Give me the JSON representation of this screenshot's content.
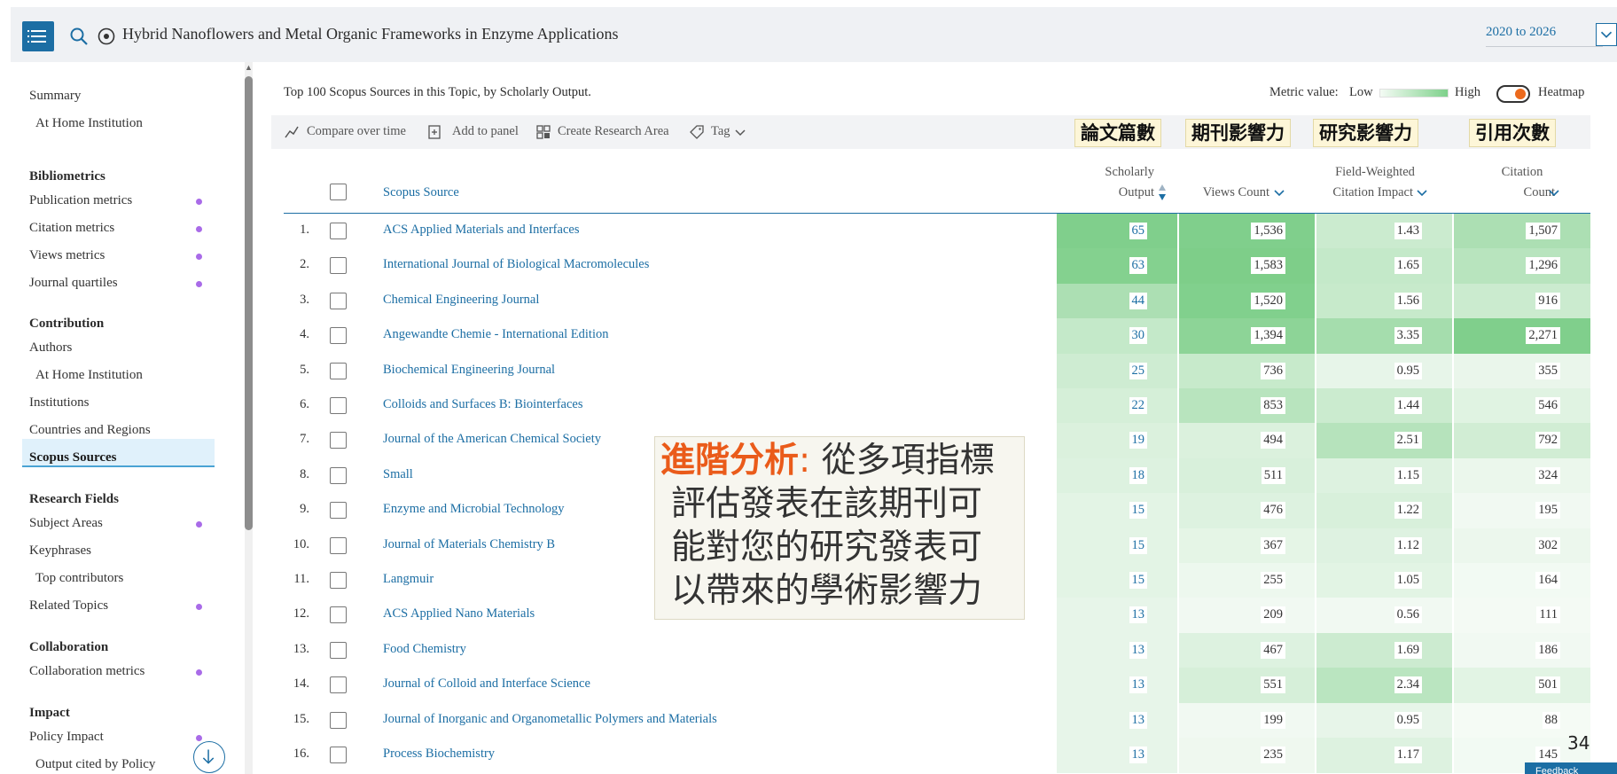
{
  "topbar": {
    "title": "Hybrid Nanoflowers and Metal Organic Frameworks in Enzyme Applications",
    "year_range": "2020 to 2026",
    "icons": [
      "menu-icon",
      "search-icon",
      "topic-icon",
      "chevron-down-icon"
    ]
  },
  "sidebar": {
    "items": [
      {
        "label": "Summary",
        "type": "item"
      },
      {
        "label": "At Home Institution",
        "type": "subitem"
      },
      {
        "label": "Bibliometrics",
        "type": "heading"
      },
      {
        "label": "Publication metrics",
        "type": "item",
        "dot": true
      },
      {
        "label": "Citation metrics",
        "type": "item",
        "dot": true
      },
      {
        "label": "Views metrics",
        "type": "item",
        "dot": true
      },
      {
        "label": "Journal quartiles",
        "type": "item",
        "dot": true
      },
      {
        "label": "Contribution",
        "type": "heading"
      },
      {
        "label": "Authors",
        "type": "item"
      },
      {
        "label": "At Home Institution",
        "type": "subitem"
      },
      {
        "label": "Institutions",
        "type": "item"
      },
      {
        "label": "Countries and Regions",
        "type": "item"
      },
      {
        "label": "Scopus Sources",
        "type": "item",
        "active": true
      },
      {
        "label": "Research Fields",
        "type": "heading"
      },
      {
        "label": "Subject Areas",
        "type": "item",
        "dot": true
      },
      {
        "label": "Keyphrases",
        "type": "item"
      },
      {
        "label": "Top contributors",
        "type": "subitem"
      },
      {
        "label": "Related Topics",
        "type": "item",
        "dot": true
      },
      {
        "label": "Collaboration",
        "type": "heading"
      },
      {
        "label": "Collaboration metrics",
        "type": "item",
        "dot": true
      },
      {
        "label": "Impact",
        "type": "heading"
      },
      {
        "label": "Policy Impact",
        "type": "item",
        "dot": true
      },
      {
        "label": "Output cited by Policy",
        "type": "subitem"
      }
    ],
    "dot_color": "#a96be8"
  },
  "main": {
    "title": "Top 100 Scopus Sources in this Topic, by Scholarly Output.",
    "metric_value_label": "Metric value:",
    "metric_low": "Low",
    "metric_high": "High",
    "heatmap_label": "Heatmap",
    "heatmap_on": true
  },
  "toolbar": {
    "compare_label": "Compare over time",
    "add_panel_label": "Add to panel",
    "create_area_label": "Create Research Area",
    "tag_label": "Tag"
  },
  "zh_labels": {
    "output": "論文篇數",
    "journal_impact": "期刊影響力",
    "research_impact": "研究影響力",
    "citations": "引用次數"
  },
  "table": {
    "headers": {
      "source": "Scopus Source",
      "scholarly_output_line1": "Scholarly",
      "scholarly_output_line2": "Output",
      "views": "Views Count",
      "fwci_line1": "Field-Weighted",
      "fwci_line2": "Citation Impact",
      "citation_line1": "Citation",
      "citation_line2": "Count"
    },
    "rows": [
      {
        "num": "1.",
        "source": "ACS Applied Materials and Interfaces",
        "output": "65",
        "views": "1,536",
        "fwci": "1.43",
        "citations": "1,507",
        "h": [
          0.95,
          0.95,
          0.35,
          0.6
        ]
      },
      {
        "num": "2.",
        "source": "International Journal of Biological Macromolecules",
        "output": "63",
        "views": "1,583",
        "fwci": "1.65",
        "citations": "1,296",
        "h": [
          0.92,
          0.97,
          0.4,
          0.5
        ]
      },
      {
        "num": "3.",
        "source": "Chemical Engineering Journal",
        "output": "44",
        "views": "1,520",
        "fwci": "1.56",
        "citations": "916",
        "h": [
          0.6,
          0.94,
          0.38,
          0.35
        ]
      },
      {
        "num": "4.",
        "source": "Angewandte Chemie - International Edition",
        "output": "30",
        "views": "1,394",
        "fwci": "3.35",
        "citations": "2,271",
        "h": [
          0.4,
          0.85,
          0.65,
          0.95
        ]
      },
      {
        "num": "5.",
        "source": "Biochemical Engineering Journal",
        "output": "25",
        "views": "736",
        "fwci": "0.95",
        "citations": "355",
        "h": [
          0.32,
          0.38,
          0.12,
          0.1
        ]
      },
      {
        "num": "6.",
        "source": "Colloids and Surfaces B: Biointerfaces",
        "output": "22",
        "views": "853",
        "fwci": "1.44",
        "citations": "546",
        "h": [
          0.27,
          0.5,
          0.35,
          0.18
        ]
      },
      {
        "num": "7.",
        "source": "Journal of the American Chemical Society",
        "output": "19",
        "views": "494",
        "fwci": "2.51",
        "citations": "792",
        "h": [
          0.22,
          0.22,
          0.52,
          0.3
        ]
      },
      {
        "num": "8.",
        "source": "Small",
        "output": "18",
        "views": "511",
        "fwci": "1.15",
        "citations": "324",
        "h": [
          0.2,
          0.24,
          0.2,
          0.09
        ]
      },
      {
        "num": "9.",
        "source": "Enzyme and Microbial Technology",
        "output": "15",
        "views": "476",
        "fwci": "1.22",
        "citations": "195",
        "h": [
          0.15,
          0.2,
          0.24,
          0.04
        ]
      },
      {
        "num": "10.",
        "source": "Journal of Materials Chemistry B",
        "output": "15",
        "views": "367",
        "fwci": "1.12",
        "citations": "302",
        "h": [
          0.15,
          0.14,
          0.19,
          0.08
        ]
      },
      {
        "num": "11.",
        "source": "Langmuir",
        "output": "15",
        "views": "255",
        "fwci": "1.05",
        "citations": "164",
        "h": [
          0.15,
          0.07,
          0.16,
          0.03
        ]
      },
      {
        "num": "12.",
        "source": "ACS Applied Nano Materials",
        "output": "13",
        "views": "209",
        "fwci": "0.56",
        "citations": "111",
        "h": [
          0.12,
          0.04,
          0.04,
          0.02
        ]
      },
      {
        "num": "13.",
        "source": "Food Chemistry",
        "output": "13",
        "views": "467",
        "fwci": "1.69",
        "citations": "186",
        "h": [
          0.12,
          0.2,
          0.34,
          0.04
        ]
      },
      {
        "num": "14.",
        "source": "Journal of Colloid and Interface Science",
        "output": "13",
        "views": "551",
        "fwci": "2.34",
        "citations": "501",
        "h": [
          0.12,
          0.26,
          0.48,
          0.16
        ]
      },
      {
        "num": "15.",
        "source": "Journal of Inorganic and Organometallic Polymers and Materials",
        "output": "13",
        "views": "199",
        "fwci": "0.95",
        "citations": "88",
        "h": [
          0.12,
          0.04,
          0.12,
          0.01
        ]
      },
      {
        "num": "16.",
        "source": "Process Biochemistry",
        "output": "13",
        "views": "235",
        "fwci": "1.17",
        "citations": "145",
        "h": [
          0.12,
          0.06,
          0.2,
          0.03
        ]
      }
    ]
  },
  "annotation": {
    "accent": "進階分析",
    "sep": ": ",
    "line1_rest": "從多項指標",
    "line2": "評估發表在該期刊可",
    "line3": "能對您的研究發表可",
    "line4": "以帶來的學術影響力"
  },
  "page_number": "34",
  "feedback_label": "Feedback"
}
